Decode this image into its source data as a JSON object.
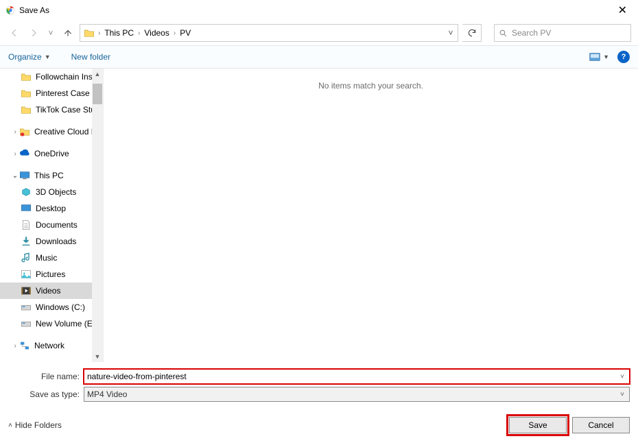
{
  "title": "Save As",
  "breadcrumb": {
    "root": "This PC",
    "folder1": "Videos",
    "folder2": "PV"
  },
  "search": {
    "placeholder": "Search PV"
  },
  "toolbar": {
    "organize": "Organize",
    "newfolder": "New folder"
  },
  "tree": {
    "quick1": "Followchain Inst",
    "quick2": "Pinterest Case St",
    "quick3": "TikTok Case Stuc",
    "cc": "Creative Cloud Fil",
    "onedrive": "OneDrive",
    "thispc": "This PC",
    "obj3d": "3D Objects",
    "desktop": "Desktop",
    "documents": "Documents",
    "downloads": "Downloads",
    "music": "Music",
    "pictures": "Pictures",
    "videos": "Videos",
    "drive_c": "Windows (C:)",
    "drive_e": "New Volume (E:)",
    "network": "Network"
  },
  "content": {
    "empty": "No items match your search."
  },
  "fields": {
    "filename_label": "File name:",
    "filename_value": "nature-video-from-pinterest",
    "type_label": "Save as type:",
    "type_value": "MP4 Video"
  },
  "bottom": {
    "hidefolders": "Hide Folders",
    "save": "Save",
    "cancel": "Cancel"
  }
}
